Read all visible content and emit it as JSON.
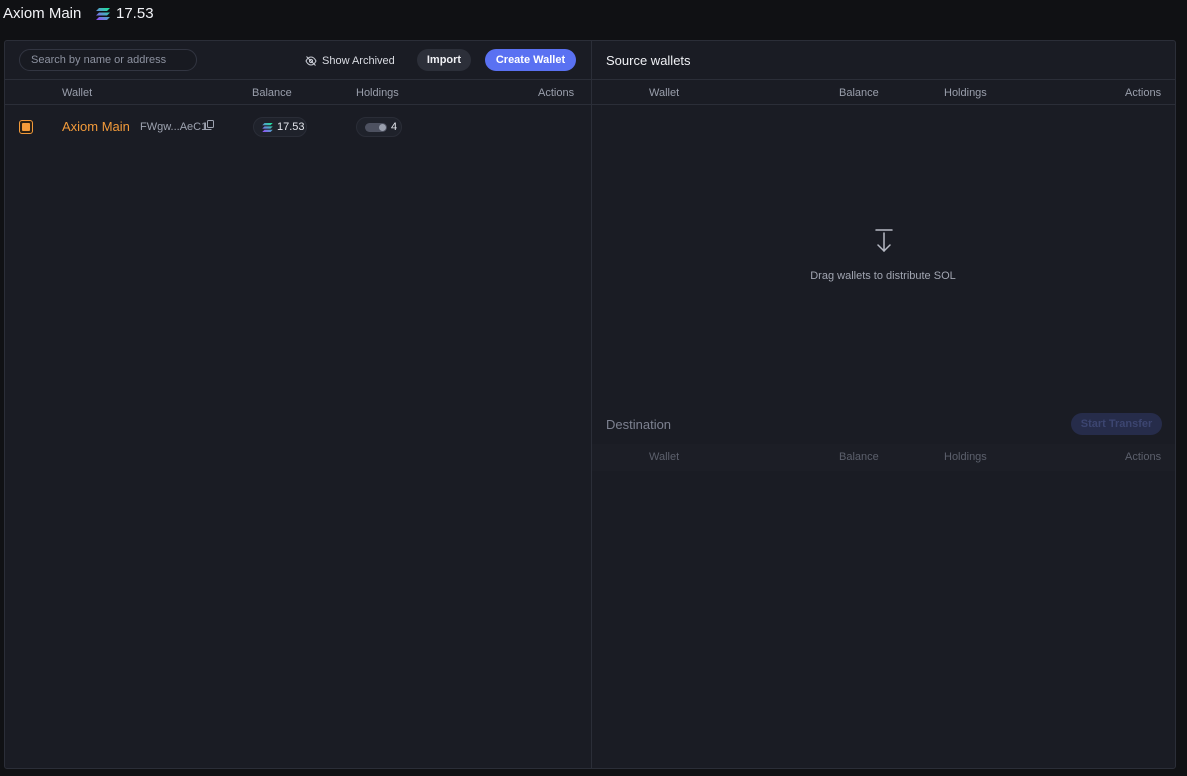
{
  "header": {
    "wallet_name": "Axiom Main",
    "balance": "17.53"
  },
  "toolbar": {
    "search_placeholder": "Search by name or address",
    "show_archived": "Show Archived",
    "import_label": "Import",
    "create_wallet_label": "Create Wallet"
  },
  "wallets_table": {
    "columns": {
      "wallet": "Wallet",
      "balance": "Balance",
      "holdings": "Holdings",
      "actions": "Actions"
    },
    "rows": [
      {
        "name": "Axiom Main",
        "address": "FWgw...AeC1",
        "balance": "17.53",
        "holdings": "4",
        "selected": true
      }
    ]
  },
  "source": {
    "title": "Source wallets",
    "columns": {
      "wallet": "Wallet",
      "balance": "Balance",
      "holdings": "Holdings",
      "actions": "Actions"
    },
    "empty_text": "Drag wallets to distribute SOL"
  },
  "destination": {
    "title": "Destination",
    "start_transfer_label": "Start Transfer",
    "columns": {
      "wallet": "Wallet",
      "balance": "Balance",
      "holdings": "Holdings",
      "actions": "Actions"
    }
  },
  "colors": {
    "accent": "#5a71f2",
    "wallet_name": "#f29a3a",
    "background": "#101114",
    "panel": "#1a1c24"
  },
  "icons": {
    "solana": "solana-icon",
    "eye_off": "eye-off-icon",
    "copy": "copy-icon",
    "drop": "arrow-down-to-line-icon",
    "toggle": "toggle-icon"
  }
}
